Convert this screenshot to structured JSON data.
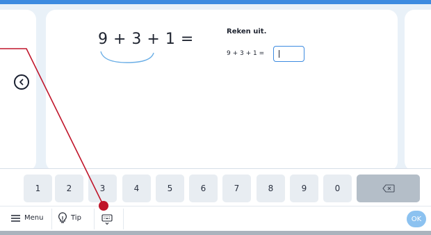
{
  "exercise": {
    "big_expression": "9 + 3 + 1 =",
    "instruction": "Reken uit.",
    "small_expression": "9 + 3 + 1 =",
    "answer_value": ""
  },
  "keypad": {
    "keys": [
      "1",
      "2",
      "3",
      "4",
      "5",
      "6",
      "7",
      "8",
      "9",
      "0"
    ]
  },
  "bottom_bar": {
    "menu_label": "Menu",
    "tip_label": "Tip",
    "ok_label": "OK"
  },
  "colors": {
    "accent": "#3d8be0",
    "annotation": "#c0152a",
    "ok": "#8cc2f0"
  },
  "icons": [
    "chevron-left-icon",
    "backspace-icon",
    "hamburger-icon",
    "lightbulb-icon",
    "keyboard-icon"
  ]
}
